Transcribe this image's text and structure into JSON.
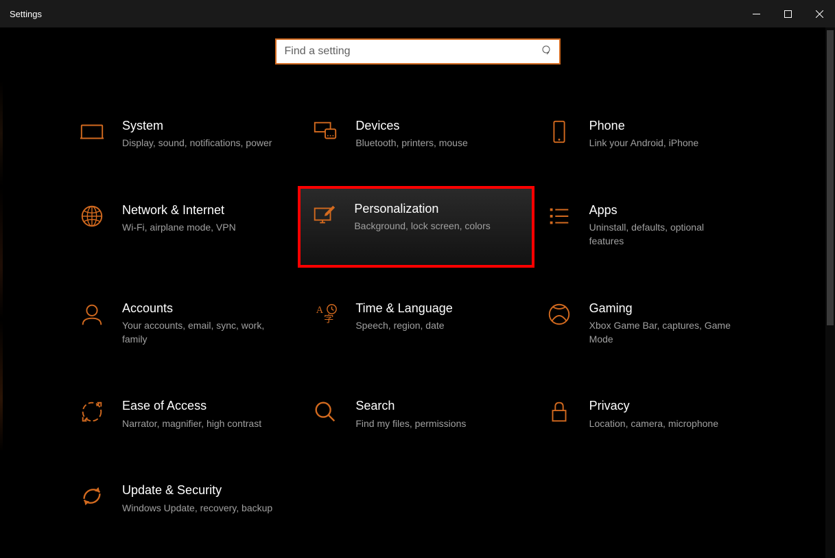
{
  "window": {
    "title": "Settings"
  },
  "search": {
    "placeholder": "Find a setting"
  },
  "accent_color": "#d36a1f",
  "highlight_color": "#ff0000",
  "tiles": {
    "system": {
      "title": "System",
      "desc": "Display, sound, notifications, power"
    },
    "devices": {
      "title": "Devices",
      "desc": "Bluetooth, printers, mouse"
    },
    "phone": {
      "title": "Phone",
      "desc": "Link your Android, iPhone"
    },
    "network": {
      "title": "Network & Internet",
      "desc": "Wi-Fi, airplane mode, VPN"
    },
    "personalization": {
      "title": "Personalization",
      "desc": "Background, lock screen, colors"
    },
    "apps": {
      "title": "Apps",
      "desc": "Uninstall, defaults, optional features"
    },
    "accounts": {
      "title": "Accounts",
      "desc": "Your accounts, email, sync, work, family"
    },
    "time": {
      "title": "Time & Language",
      "desc": "Speech, region, date"
    },
    "gaming": {
      "title": "Gaming",
      "desc": "Xbox Game Bar, captures, Game Mode"
    },
    "ease": {
      "title": "Ease of Access",
      "desc": "Narrator, magnifier, high contrast"
    },
    "search_tile": {
      "title": "Search",
      "desc": "Find my files, permissions"
    },
    "privacy": {
      "title": "Privacy",
      "desc": "Location, camera, microphone"
    },
    "update": {
      "title": "Update & Security",
      "desc": "Windows Update, recovery, backup"
    }
  }
}
